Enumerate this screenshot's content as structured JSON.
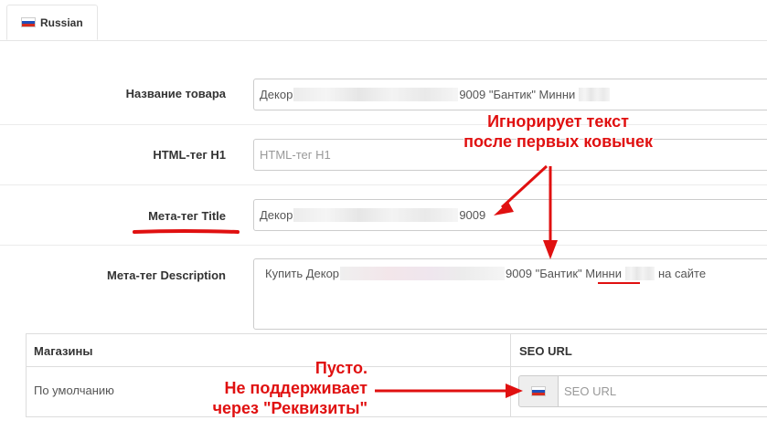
{
  "tabs": [
    {
      "label": "Russian",
      "flag": "flag-ru-icon",
      "active": true
    }
  ],
  "form": {
    "product_name": {
      "label": "Название товара",
      "value_prefix": "Декор",
      "value_middle": "9009 \"Бантик\" Минни"
    },
    "html_h1": {
      "label": "HTML-тег H1",
      "placeholder": "HTML-тег H1"
    },
    "meta_title": {
      "label": "Мета-тег Title",
      "value_prefix": "Декор",
      "value_suffix": "9009"
    },
    "meta_description": {
      "label": "Мета-тег Description",
      "value_prefix": "Купить Декор",
      "value_middle": "9009 \"Бантик\"",
      "value_underlined": "Минни",
      "value_suffix": "на сайте"
    }
  },
  "stores_table": {
    "col_store": "Магазины",
    "col_seo": "SEO URL",
    "rows": [
      {
        "store": "По умолчанию",
        "seo_placeholder": "SEO URL"
      }
    ]
  },
  "annotations": {
    "title_note_line1": "Игнорирует текст",
    "title_note_line2": "после первых ковычек",
    "seo_note_line1": "Пусто.",
    "seo_note_line2": "Не поддерживает",
    "seo_note_line3": "через \"Реквизиты\""
  },
  "colors": {
    "annotation": "#e01010",
    "border": "#cccccc"
  }
}
